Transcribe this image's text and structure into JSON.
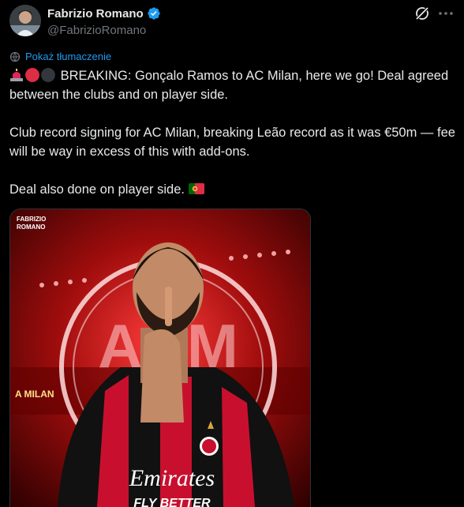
{
  "author": {
    "display_name": "Fabrizio Romano",
    "handle": "@FabrizioRomano",
    "verified": true,
    "avatar_icon": "avatar-photo"
  },
  "actions": {
    "grok_icon": "grok-icon",
    "more_icon": "more-icon"
  },
  "translate": {
    "label": "Pokaż tłumaczenie",
    "icon": "translate-globe-icon"
  },
  "tweet": {
    "paragraph1": "BREAKING: Gonçalo Ramos to AC Milan, here we go! Deal agreed between the clubs and on player side.",
    "paragraph2": "Club record signing for AC Milan, breaking Leão record as it was €50m — fee will be way in excess of this with add-ons.",
    "paragraph3": "Deal also done on player side.",
    "emojis": [
      "siren-emoji",
      "red-circle-emoji",
      "black-circle-emoji",
      "portugal-flag-emoji"
    ]
  },
  "media": {
    "watermark_line1": "FABRIZIO",
    "watermark_line2": "ROMANO",
    "sponsor_text": "Emirates",
    "sponsor_tagline": "FLY BETTER",
    "club_crest_text": "ACM",
    "stadium_banner": "A MILAN"
  },
  "colors": {
    "background": "#000000",
    "text": "#e7e9ea",
    "secondary": "#71767b",
    "link": "#1d9bf0",
    "verified": "#1d9bf0",
    "milan_red": "#c8102e"
  }
}
